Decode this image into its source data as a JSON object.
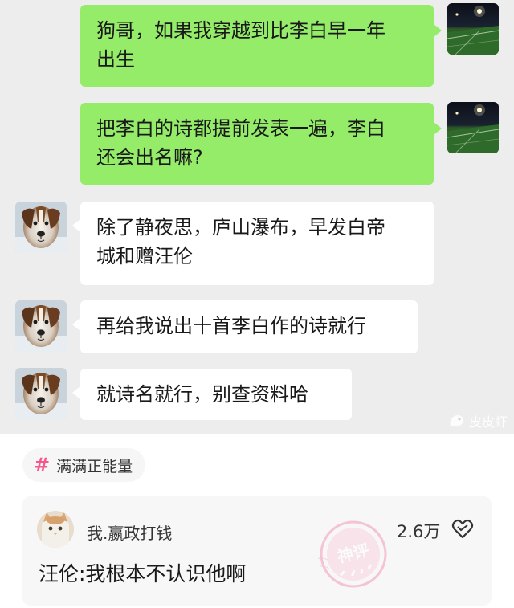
{
  "chat": {
    "messages": [
      {
        "side": "right",
        "text": "狗哥，如果我穿越到比李白早一年出生",
        "line1": "狗哥，如果我穿越到比李白早一年",
        "line2": "出生"
      },
      {
        "side": "right",
        "text": "把李白的诗都提前发表一遍，李白还会出名嘛?",
        "line1": "把李白的诗都提前发表一遍，李白",
        "line2": "还会出名嘛?"
      },
      {
        "side": "left",
        "text": "除了静夜思，庐山瀑布，早发白帝城和赠汪伦",
        "line1": "除了静夜思，庐山瀑布，早发白帝",
        "line2": "城和赠汪伦"
      },
      {
        "side": "left",
        "text": "再给我说出十首李白作的诗就行"
      },
      {
        "side": "left",
        "text": "就诗名就行，别查资料哈"
      }
    ],
    "watermark": "皮皮虾"
  },
  "tag": {
    "label": "满满正能量",
    "hash": "#"
  },
  "comment": {
    "username": "我.嬴政打钱",
    "likes": "2.6万",
    "text": "汪伦:我根本不认识他啊",
    "stamp_text": "神评"
  },
  "colors": {
    "chat_bg": "#ededed",
    "green_bubble": "#95ec69",
    "white_bubble": "#ffffff",
    "accent_pink": "#f5588a",
    "card_bg": "#f7f7f7"
  },
  "icons": [
    "field-avatar-icon",
    "dog-avatar-icon",
    "watermark-logo-icon",
    "hash-icon",
    "cat-avatar-icon",
    "like-heart-icon",
    "god-comment-stamp-icon"
  ]
}
